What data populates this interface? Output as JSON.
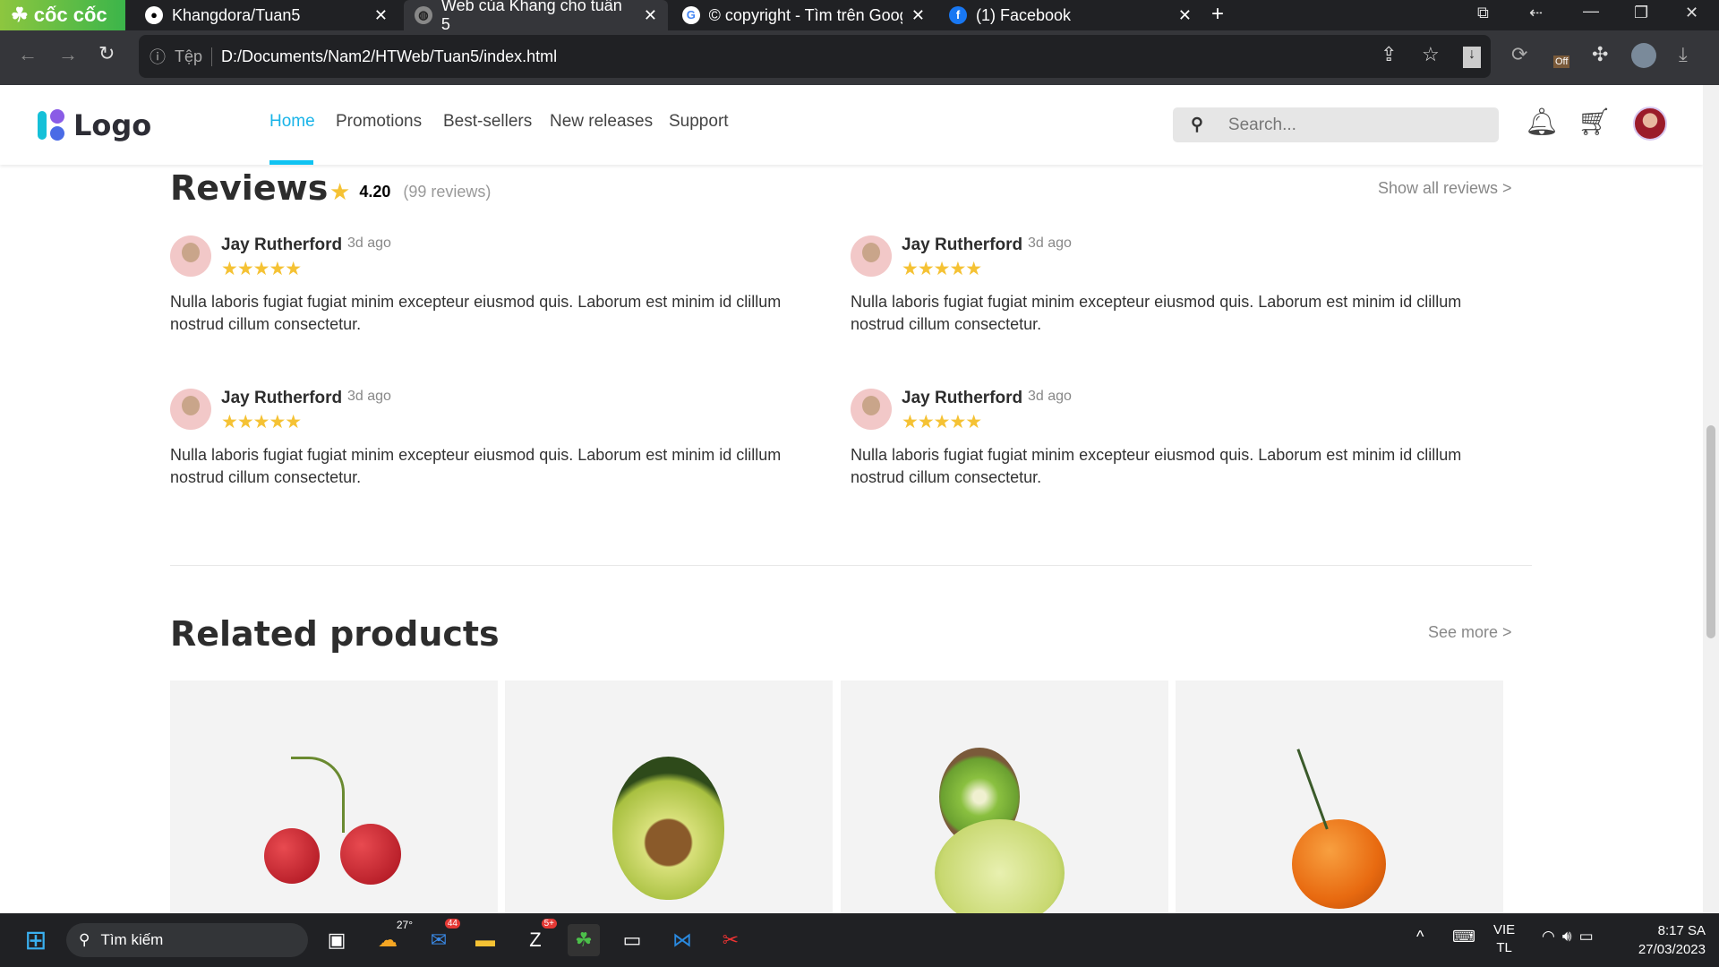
{
  "browser": {
    "brand": "cốc cốc",
    "tabs": [
      {
        "title": "Khangdora/Tuan5",
        "icon": "github-icon"
      },
      {
        "title": "Web của Khang cho tuần 5",
        "icon": "globe-icon",
        "active": true
      },
      {
        "title": "© copyright - Tìm trên Goog",
        "icon": "google-icon"
      },
      {
        "title": "(1) Facebook",
        "icon": "facebook-icon"
      }
    ],
    "new_tab": "+",
    "url_prefix": "Tệp",
    "url": "D:/Documents/Nam2/HTWeb/Tuan5/index.html",
    "ext_badge": "Off"
  },
  "header": {
    "logo": "Logo",
    "nav": [
      "Home",
      "Promotions",
      "Best-sellers",
      "New releases",
      "Support"
    ],
    "active": "Home",
    "search_placeholder": "Search..."
  },
  "reviews": {
    "title": "Reviews",
    "rating": "4.20",
    "count": "(99 reviews)",
    "show_all": "Show all reviews >",
    "items": [
      {
        "name": "Jay Rutherford",
        "time": "3d ago",
        "stars": 5,
        "text": "Nulla laboris fugiat fugiat minim excepteur eiusmod quis. Laborum est minim id clillum nostrud cillum consectetur."
      },
      {
        "name": "Jay Rutherford",
        "time": "3d ago",
        "stars": 5,
        "text": "Nulla laboris fugiat fugiat minim excepteur eiusmod quis. Laborum est minim id clillum nostrud cillum consectetur."
      },
      {
        "name": "Jay Rutherford",
        "time": "3d ago",
        "stars": 5,
        "text": "Nulla laboris fugiat fugiat minim excepteur eiusmod quis. Laborum est minim id clillum nostrud cillum consectetur."
      },
      {
        "name": "Jay Rutherford",
        "time": "3d ago",
        "stars": 5,
        "text": "Nulla laboris fugiat fugiat minim excepteur eiusmod quis. Laborum est minim id clillum nostrud cillum consectetur."
      }
    ]
  },
  "related": {
    "title": "Related products",
    "see_more": "See more >",
    "products": [
      "cherry",
      "avocado",
      "kiwi-lime",
      "tangerine"
    ]
  },
  "taskbar": {
    "search": "Tìm kiếm",
    "weather": "27°",
    "mail_badge": "44",
    "zalo_badge": "5+",
    "lang1": "VIE",
    "lang2": "TL",
    "time": "8:17 SA",
    "date": "27/03/2023"
  }
}
